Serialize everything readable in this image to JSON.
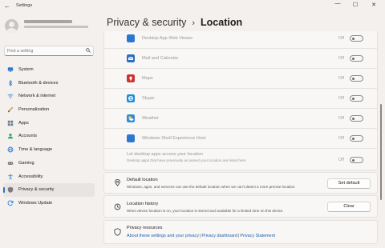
{
  "window": {
    "title": "Settings",
    "back_glyph": "←",
    "minimize_glyph": "—",
    "maximize_glyph": "☐",
    "close_glyph": "✕"
  },
  "search": {
    "placeholder": "Find a setting"
  },
  "sidebar": {
    "items": [
      {
        "label": "System",
        "icon": "monitor-icon",
        "color": "#2e7bd1"
      },
      {
        "label": "Bluetooth & devices",
        "icon": "bluetooth-icon",
        "color": "#2e7bd1"
      },
      {
        "label": "Network & internet",
        "icon": "wifi-icon",
        "color": "#3a7ec9"
      },
      {
        "label": "Personalization",
        "icon": "brush-icon",
        "color": "#d08a3c"
      },
      {
        "label": "Apps",
        "icon": "apps-icon",
        "color": "#6b7a8f"
      },
      {
        "label": "Accounts",
        "icon": "person-icon",
        "color": "#2fa36a"
      },
      {
        "label": "Time & language",
        "icon": "globe-icon",
        "color": "#2e7bd1"
      },
      {
        "label": "Gaming",
        "icon": "gamepad-icon",
        "color": "#767676"
      },
      {
        "label": "Accessibility",
        "icon": "accessibility-icon",
        "color": "#2e7bd1"
      },
      {
        "label": "Privacy & security",
        "icon": "shield-icon",
        "color": "#7b7b7b",
        "active": true
      },
      {
        "label": "Windows Update",
        "icon": "update-icon",
        "color": "#2e7bd1"
      }
    ]
  },
  "header": {
    "parent": "Privacy & security",
    "separator": "›",
    "current": "Location"
  },
  "apps": [
    {
      "name": "Desktop App Web Viewer",
      "state": "Off",
      "icon": "web-viewer-icon",
      "color": "#2b78d1"
    },
    {
      "name": "Mail and Calendar",
      "state": "Off",
      "icon": "mail-icon",
      "color": "#2b6fc0"
    },
    {
      "name": "Maps",
      "state": "Off",
      "icon": "maps-icon",
      "color": "#c8352f"
    },
    {
      "name": "Skype",
      "state": "Off",
      "icon": "skype-icon",
      "color": "#1a8cd8"
    },
    {
      "name": "Weather",
      "state": "Off",
      "icon": "weather-icon",
      "color": "#2f8cdb"
    },
    {
      "name": "Windows Shell Experience Host",
      "state": "Off",
      "icon": "shell-host-icon",
      "color": "#2b78d1"
    }
  ],
  "desktop_access": {
    "title": "Let desktop apps access your location",
    "desc": "Desktop apps that have previously accessed your location are listed here",
    "state": "Off"
  },
  "default_location": {
    "title": "Default location",
    "desc": "Windows, apps, and services can use the default location when we can't detect a more precise location",
    "button": "Set default"
  },
  "location_history": {
    "title": "Location history",
    "desc": "When device location is on, your location is stored and available for a limited time on this device",
    "button": "Clear"
  },
  "privacy_resources": {
    "title": "Privacy resources",
    "links": [
      "About these settings and your privacy",
      "Privacy dashboard",
      "Privacy Statement"
    ],
    "separator": "|"
  }
}
